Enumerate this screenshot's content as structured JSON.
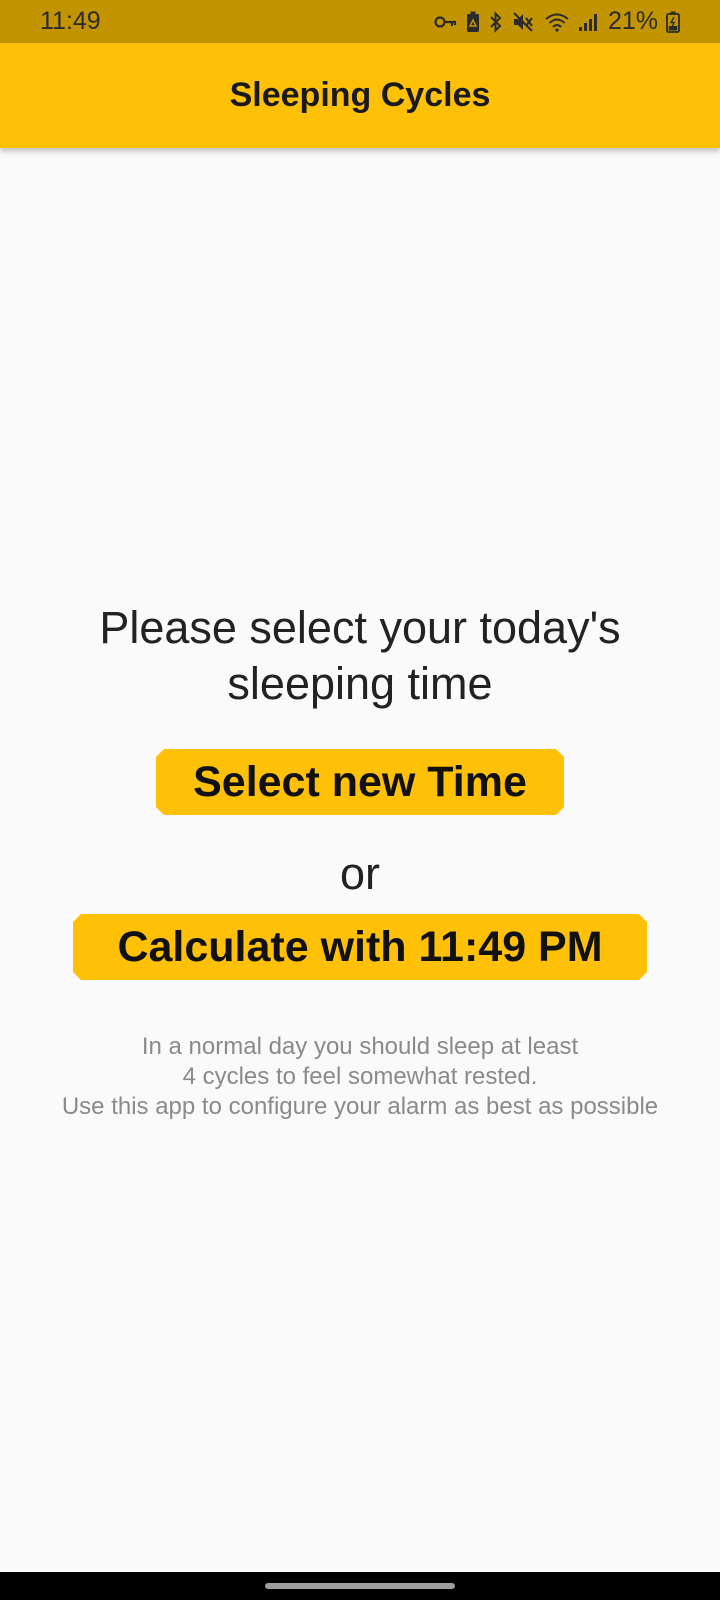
{
  "status_bar": {
    "time": "11:49",
    "battery_percent": "21%",
    "icons": [
      "key-icon",
      "recycle-battery-icon",
      "bluetooth-icon",
      "mute-icon",
      "wifi-icon",
      "signal-icon",
      "battery-icon"
    ]
  },
  "app_bar": {
    "title": "Sleeping Cycles"
  },
  "main": {
    "prompt": "Please select your today's sleeping time",
    "select_button_label": "Select new Time",
    "or_label": "or",
    "calculate_button_label": "Calculate with 11:49 PM",
    "info_lines": [
      "In a normal day you should sleep at least",
      "4 cycles to feel somewhat rested.",
      "Use this app to configure your alarm as best as possible"
    ]
  },
  "colors": {
    "accent": "#ffc107",
    "status_bar": "#c29400",
    "background": "#fafafa"
  }
}
